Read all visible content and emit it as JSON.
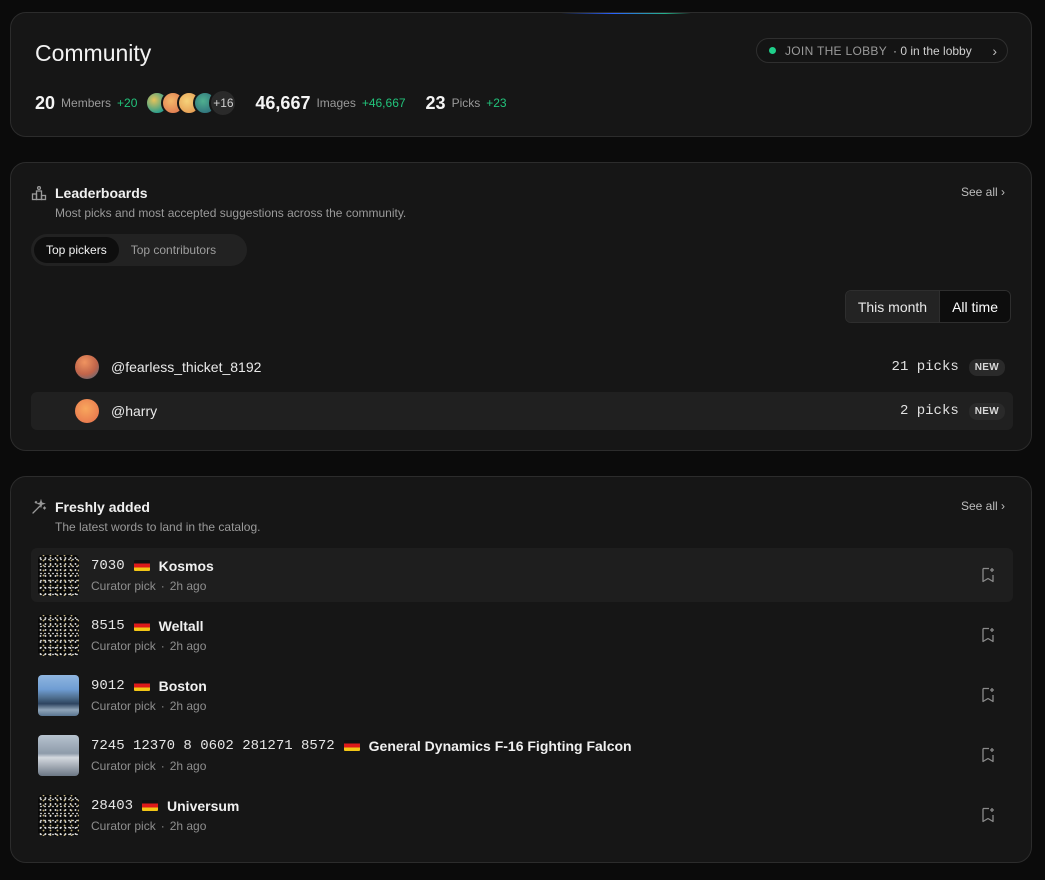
{
  "community": {
    "title": "Community",
    "lobby": {
      "label": "JOIN THE LOBBY",
      "count": "· 0 in the lobby",
      "chevron": "›"
    },
    "members": {
      "value": "20",
      "label": "Members",
      "delta": "+20",
      "more": "+16"
    },
    "images": {
      "value": "46,667",
      "label": "Images",
      "delta": "+46,667"
    },
    "picks": {
      "value": "23",
      "label": "Picks",
      "delta": "+23"
    }
  },
  "leaderboards": {
    "title": "Leaderboards",
    "subtitle": "Most picks and most accepted suggestions across the community.",
    "see_all": "See all ›",
    "tabs": [
      "Top pickers",
      "Top contributors"
    ],
    "ranges": [
      "This month",
      "All time"
    ],
    "rows": [
      {
        "name": "@fearless_thicket_8192",
        "picks": "21 picks",
        "badge": "NEW"
      },
      {
        "name": "@harry",
        "picks": "2 picks",
        "badge": "NEW"
      }
    ]
  },
  "fresh": {
    "title": "Freshly added",
    "subtitle": "The latest words to land in the catalog.",
    "see_all": "See all ›",
    "items": [
      {
        "ids": "7030",
        "word": "Kosmos",
        "source": "Curator pick",
        "time": "2h ago",
        "thumb": "stars"
      },
      {
        "ids": "8515",
        "word": "Weltall",
        "source": "Curator pick",
        "time": "2h ago",
        "thumb": "stars"
      },
      {
        "ids": "9012",
        "word": "Boston",
        "source": "Curator pick",
        "time": "2h ago",
        "thumb": "city"
      },
      {
        "ids": "7245 12370 8 0602 281271 8572",
        "word": "General Dynamics F-16 Fighting Falcon",
        "source": "Curator pick",
        "time": "2h ago",
        "thumb": "jet"
      },
      {
        "ids": "28403",
        "word": "Universum",
        "source": "Curator pick",
        "time": "2h ago",
        "thumb": "stars"
      }
    ]
  },
  "colors": {
    "accent_green": "#22c37b",
    "card_bg": "#161616",
    "page_bg": "#0b0b0b"
  }
}
